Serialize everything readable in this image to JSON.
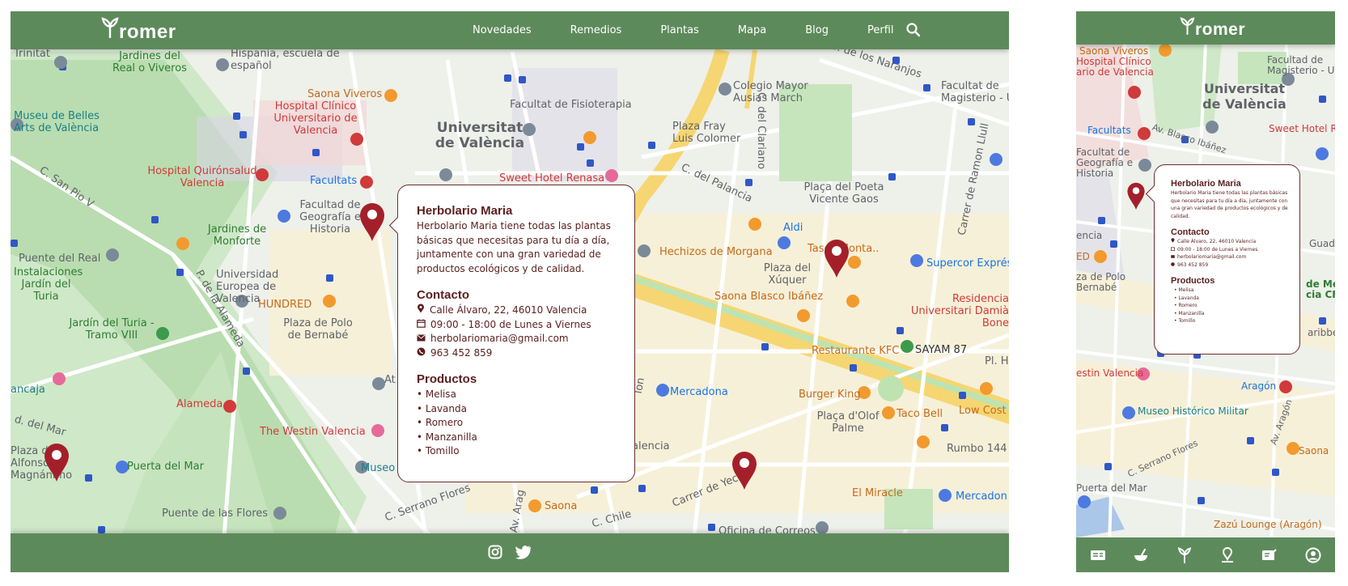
{
  "brand": {
    "name": "romer",
    "name_initial": "Y"
  },
  "nav": {
    "items": [
      {
        "label": "Novedades"
      },
      {
        "label": "Remedios"
      },
      {
        "label": "Plantas"
      },
      {
        "label": "Mapa"
      },
      {
        "label": "Blog"
      },
      {
        "label": "Perfil"
      }
    ],
    "search_icon": "search-icon"
  },
  "colors": {
    "header": "#5d8a5b",
    "pin": "#a3202a",
    "popup_text": "#5a1e1e",
    "popup_border": "#6b2d2d"
  },
  "map_labels": {
    "trinitat": "Trinitat",
    "jardines_real": "Jardines del Real o Viveros",
    "hispania": "Hispania, escuela de español",
    "museu_belles": "Museu de Belles Arts de València",
    "saona_viveros": "Saona Viveros",
    "hospital_clinico": "Hospital Clínico Universitario de Valencia",
    "fac_fisioterapia": "Facultat de Fisioterapia",
    "colegio_mayor": "Colegio Mayor Ausias March",
    "av_naranjos": "Av. de los Naranjos",
    "fac_magisterio": "Facultat de Magisterio - U",
    "univ_valencia": "Universitat de València",
    "plaza_fray": "Plaza Fray Luis Colomer",
    "c_clariano": "C. del Clariano",
    "carrer_ramon": "Carrer de Ramon Llull",
    "c_san_pio": "C. San Pio V",
    "hospital_quiron": "Hospital Quirónsalud Valencia",
    "facultats": "Facultats",
    "sweet_hotel": "Sweet Hotel Renasa",
    "c_palancia": "C. del Palancia",
    "placa_poeta": "Plaça del Poeta Vicente Gaos",
    "fac_geografia": "Facultad de Geografía e Historia",
    "jardines_monforte": "Jardines de Monforte",
    "hechizos": "Hechizos de Morgana",
    "aldi": "Aldi",
    "tasca_monta": "Tasca Monta..",
    "supercor": "Supercor Exprés",
    "puente_real": "Puente del Real",
    "instalaciones": "Instalaciones Jardín del Turia",
    "univ_europea": "Universidad Europea de Valencia",
    "p_alameda": "P. de la Alameda",
    "plaza_xuquer": "Plaza del Xúquer",
    "saona_blasco": "Saona Blasco Ibáñez",
    "residencia": "Residencia Universitari Damià Bone",
    "hundred": "HUNDRED",
    "plaza_polo": "Plaza de Polo de Bernabé",
    "jardin_turia": "Jardín del Turia - Tramo VIII",
    "restaurante_kfc": "Restaurante KFC",
    "sayam": "SAYAM 87",
    "pl_ho": "Pl. Ho",
    "ancaja": "ancaja",
    "mercadona": "Mercadona",
    "burger_king": "Burger King",
    "low_cost": "Low Cost",
    "alameda": "Alameda",
    "d_mar": "d. del Mar",
    "westin": "The Westin Valencia",
    "taco_bell": "Taco Bell",
    "placa_olof": "Plaça d'Olof Palme",
    "plaza_alfonso": "Plaza de Alfonso Magnánimo",
    "puerta_mar": "Puerta del Mar",
    "museo": "Museo",
    "alencia": "alencia",
    "rumbo": "Rumbo 144",
    "carrer_yecla": "Carrer de Yecla",
    "c_serrano": "C. Serrano Flores",
    "el_miracle": "El Miracle",
    "mercadona2": "Mercadon",
    "puente_flores": "Puente de las Flores",
    "saona": "Saona",
    "c_chile": "C. Chile",
    "oficina_correos": "Oficina de Correos",
    "av_aragon": "Av. Arag",
    "av_bl": "Av. Bl",
    "at": "At",
    "lon": "lon",
    "valencia_small": "Valencia",
    "sweet_hotel_r": "Sweet Hotel R",
    "guada": "Guada",
    "ed": "ED",
    "de_me": "de Me",
    "cia_cf": "cia CF",
    "aribbea": "aribbea",
    "estin_valencia": "estin Valencia",
    "aragon": "Aragón",
    "museo_historico": "Museo Histórico Militar",
    "c_serrano_flores": "C. Serrano Flores",
    "puerto_del_mar": "Puerta del Mar",
    "zazu": "Zazú Lounge (Aragón)",
    "saona_m": "Saona",
    "av_aragon_m": "Av. Aragón",
    "za_de_polo": "za de Polo Bernabé",
    "ncia": "encia",
    "facultad_m": "Facultat de Geografía e Historia",
    "universitat_m": "Universitat de València",
    "facultad_magisterio_m": "Facultad de Magisterio - U",
    "saona_viveros_m": "Saona Viveros",
    "hospital_m": "Hospital Clínico ario de Valencia",
    "facultats_m": "Facultats",
    "av_blasco_m": "Av. Blasco Ibáñez"
  },
  "popup": {
    "title": "Herbolario Maria",
    "description": "Herbolario Maria tiene todas las plantas básicas que necesitas para tu día a día, juntamente con una gran variedad de productos ecológicos y de calidad.",
    "contact_title": "Contacto",
    "address": "Calle Álvaro, 22, 46010 Valencia",
    "hours": "09:00 - 18:00 de Lunes a Viernes",
    "email": "herbolariomaria@gmail.com",
    "phone": "963 452 859",
    "products_title": "Productos",
    "products": [
      "Melisa",
      "Lavanda",
      "Romero",
      "Manzanilla",
      "Tomillo"
    ]
  },
  "footer": {
    "icons": [
      "instagram-icon",
      "twitter-icon"
    ]
  },
  "mobile_tabs": {
    "icons": [
      "news-icon",
      "remedies-icon",
      "plants-icon",
      "map-icon",
      "blog-icon",
      "profile-icon"
    ]
  }
}
